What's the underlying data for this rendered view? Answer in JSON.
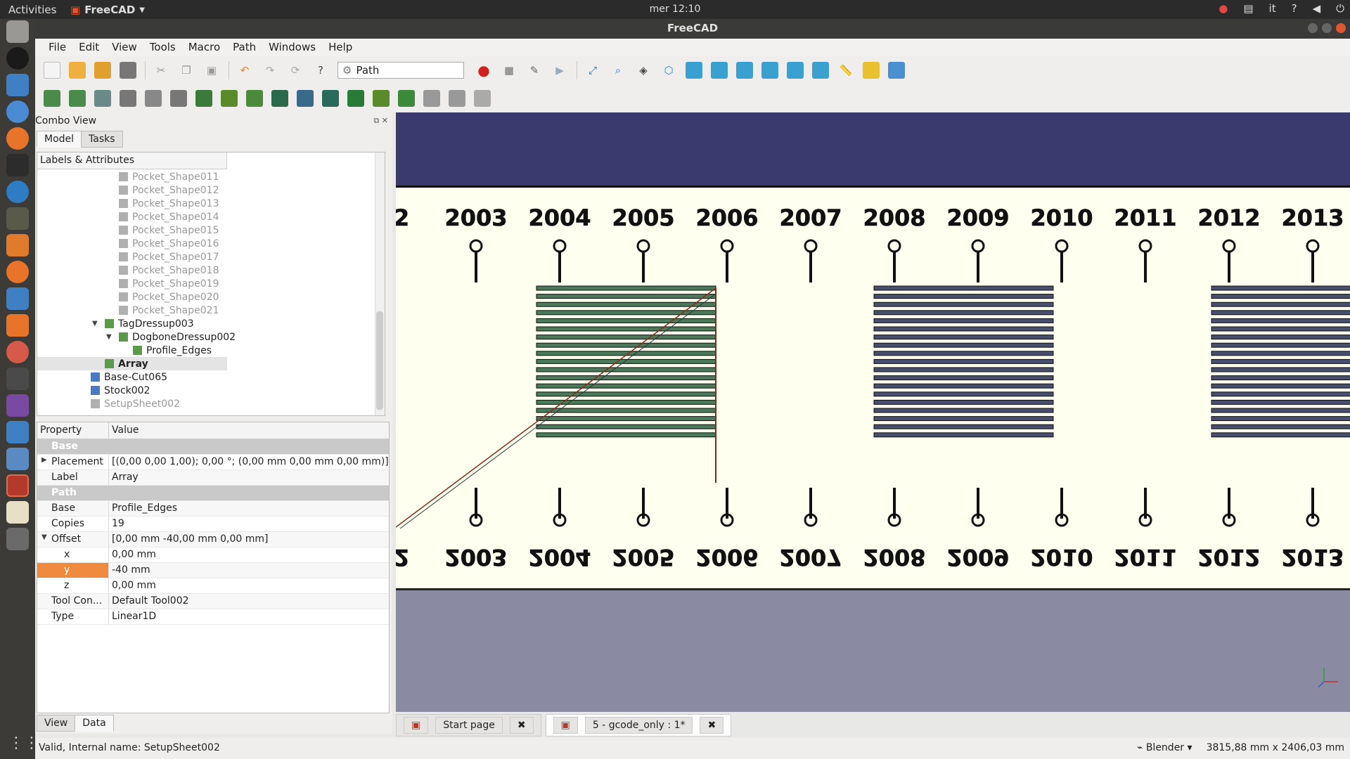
{
  "topbar": {
    "activities": "Activities",
    "app": "FreeCAD",
    "clock": "mer 12:10",
    "lang": "it"
  },
  "window": {
    "title": "FreeCAD"
  },
  "menu": [
    "File",
    "Edit",
    "View",
    "Tools",
    "Macro",
    "Path",
    "Windows",
    "Help"
  ],
  "workbench": "Path",
  "combo": {
    "title": "Combo View",
    "tabs": [
      "Model",
      "Tasks"
    ],
    "tree_header": "Labels & Attributes",
    "bottom_tabs": [
      "View",
      "Data"
    ]
  },
  "tree": [
    {
      "label": "Pocket_Shape011",
      "indent": 2,
      "dim": true
    },
    {
      "label": "Pocket_Shape012",
      "indent": 2,
      "dim": true
    },
    {
      "label": "Pocket_Shape013",
      "indent": 2,
      "dim": true
    },
    {
      "label": "Pocket_Shape014",
      "indent": 2,
      "dim": true
    },
    {
      "label": "Pocket_Shape015",
      "indent": 2,
      "dim": true
    },
    {
      "label": "Pocket_Shape016",
      "indent": 2,
      "dim": true
    },
    {
      "label": "Pocket_Shape017",
      "indent": 2,
      "dim": true
    },
    {
      "label": "Pocket_Shape018",
      "indent": 2,
      "dim": true
    },
    {
      "label": "Pocket_Shape019",
      "indent": 2,
      "dim": true
    },
    {
      "label": "Pocket_Shape020",
      "indent": 2,
      "dim": true
    },
    {
      "label": "Pocket_Shape021",
      "indent": 2,
      "dim": true
    },
    {
      "label": "TagDressup003",
      "indent": 1,
      "arrow": "▼"
    },
    {
      "label": "DogboneDressup002",
      "indent": 2,
      "arrow": "▼"
    },
    {
      "label": "Profile_Edges",
      "indent": 3
    },
    {
      "label": "Array",
      "indent": 1,
      "bold": true,
      "selected": true
    },
    {
      "label": "Base-Cut065",
      "indent": 0
    },
    {
      "label": "Stock002",
      "indent": 0
    },
    {
      "label": "SetupSheet002",
      "indent": 0,
      "dim": true
    }
  ],
  "properties": {
    "header": [
      "Property",
      "Value"
    ],
    "rows": [
      {
        "key": "Base",
        "group": true
      },
      {
        "key": "Placement",
        "value": "[(0,00 0,00 1,00); 0,00 °; (0,00 mm  0,00 mm  0,00 mm)]",
        "arrow": "▶"
      },
      {
        "key": "Label",
        "value": "Array"
      },
      {
        "key": "Path",
        "group": true
      },
      {
        "key": "Base",
        "value": "Profile_Edges"
      },
      {
        "key": "Copies",
        "value": "19"
      },
      {
        "key": "Offset",
        "value": "[0,00 mm  -40,00 mm  0,00 mm]",
        "arrow": "▼"
      },
      {
        "key": "x",
        "value": "0,00 mm",
        "sub": true
      },
      {
        "key": "y",
        "value": "-40 mm",
        "sub": true,
        "highlight": true
      },
      {
        "key": "z",
        "value": "0,00 mm",
        "sub": true
      },
      {
        "key": "Tool Con...",
        "value": "Default Tool002"
      },
      {
        "key": "Type",
        "value": "Linear1D"
      }
    ]
  },
  "viewport": {
    "years_top": [
      "2",
      "2003",
      "2004",
      "2005",
      "2006",
      "2007",
      "2008",
      "2009",
      "2010",
      "2011",
      "2012",
      "2013"
    ],
    "years_bottom": [
      "2",
      "2003",
      "2004",
      "2005",
      "2006",
      "2007",
      "2008",
      "2009",
      "2010",
      "2011",
      "2012",
      "2013"
    ],
    "colors": {
      "sky": "#3a3a6e",
      "paper": "#fffff0",
      "ground": "#8a8aa2",
      "green": "#4a7a5a",
      "slate": "#4a4e6e"
    }
  },
  "doctabs": [
    {
      "label": "Start page"
    },
    {
      "label": "5 - gcode_only : 1*",
      "active": true
    }
  ],
  "status": {
    "left": "Valid, Internal name: SetupSheet002",
    "nav": "Blender",
    "dims": "3815,88 mm x 2406,03 mm"
  }
}
